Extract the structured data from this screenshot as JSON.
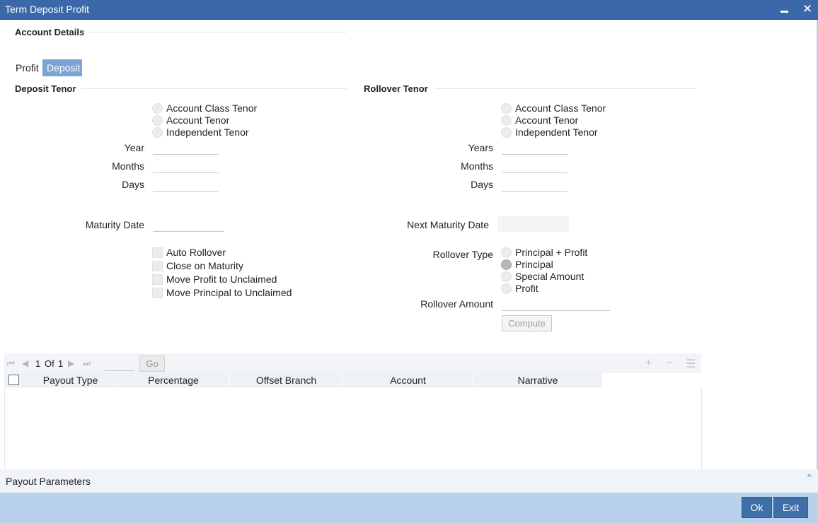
{
  "window": {
    "title": "Term Deposit Profit",
    "min_icon": "minimize-icon",
    "close_icon": "close-icon",
    "close_glyph": "✕"
  },
  "account_details": {
    "title": "Account Details"
  },
  "tabs": [
    {
      "label": "Profit",
      "active": false
    },
    {
      "label": "Deposit",
      "active": true
    }
  ],
  "deposit_tenor": {
    "title": "Deposit Tenor",
    "options": [
      "Account Class Tenor",
      "Account Tenor",
      "Independent Tenor"
    ],
    "year_label": "Year",
    "months_label": "Months",
    "days_label": "Days",
    "maturity_date_label": "Maturity Date",
    "checkboxes": [
      "Auto Rollover",
      "Close on Maturity",
      "Move Profit to Unclaimed",
      "Move Principal to Unclaimed"
    ]
  },
  "rollover_tenor": {
    "title": "Rollover Tenor",
    "options": [
      "Account Class Tenor",
      "Account Tenor",
      "Independent Tenor"
    ],
    "years_label": "Years",
    "months_label": "Months",
    "days_label": "Days",
    "next_maturity_date_label": "Next Maturity Date",
    "rollover_type_label": "Rollover Type",
    "rollover_types": [
      "Principal + Profit",
      "Principal",
      "Special Amount",
      "Profit"
    ],
    "rollover_type_selected": "Principal",
    "rollover_amount_label": "Rollover Amount",
    "compute_label": "Compute"
  },
  "grid": {
    "page_current": "1",
    "page_of": "Of",
    "page_total": "1",
    "go_label": "Go",
    "columns": [
      "Payout Type",
      "Percentage",
      "Offset Branch",
      "Account",
      "Narrative"
    ]
  },
  "payout_parameters": {
    "label": "Payout Parameters",
    "caret": "^"
  },
  "footer": {
    "ok_label": "Ok",
    "exit_label": "Exit"
  },
  "colors": {
    "title_bar": "#3b68a8",
    "tab_active": "#7ba3d4",
    "footer": "#b9d1ea",
    "button": "#3f6fa8"
  }
}
